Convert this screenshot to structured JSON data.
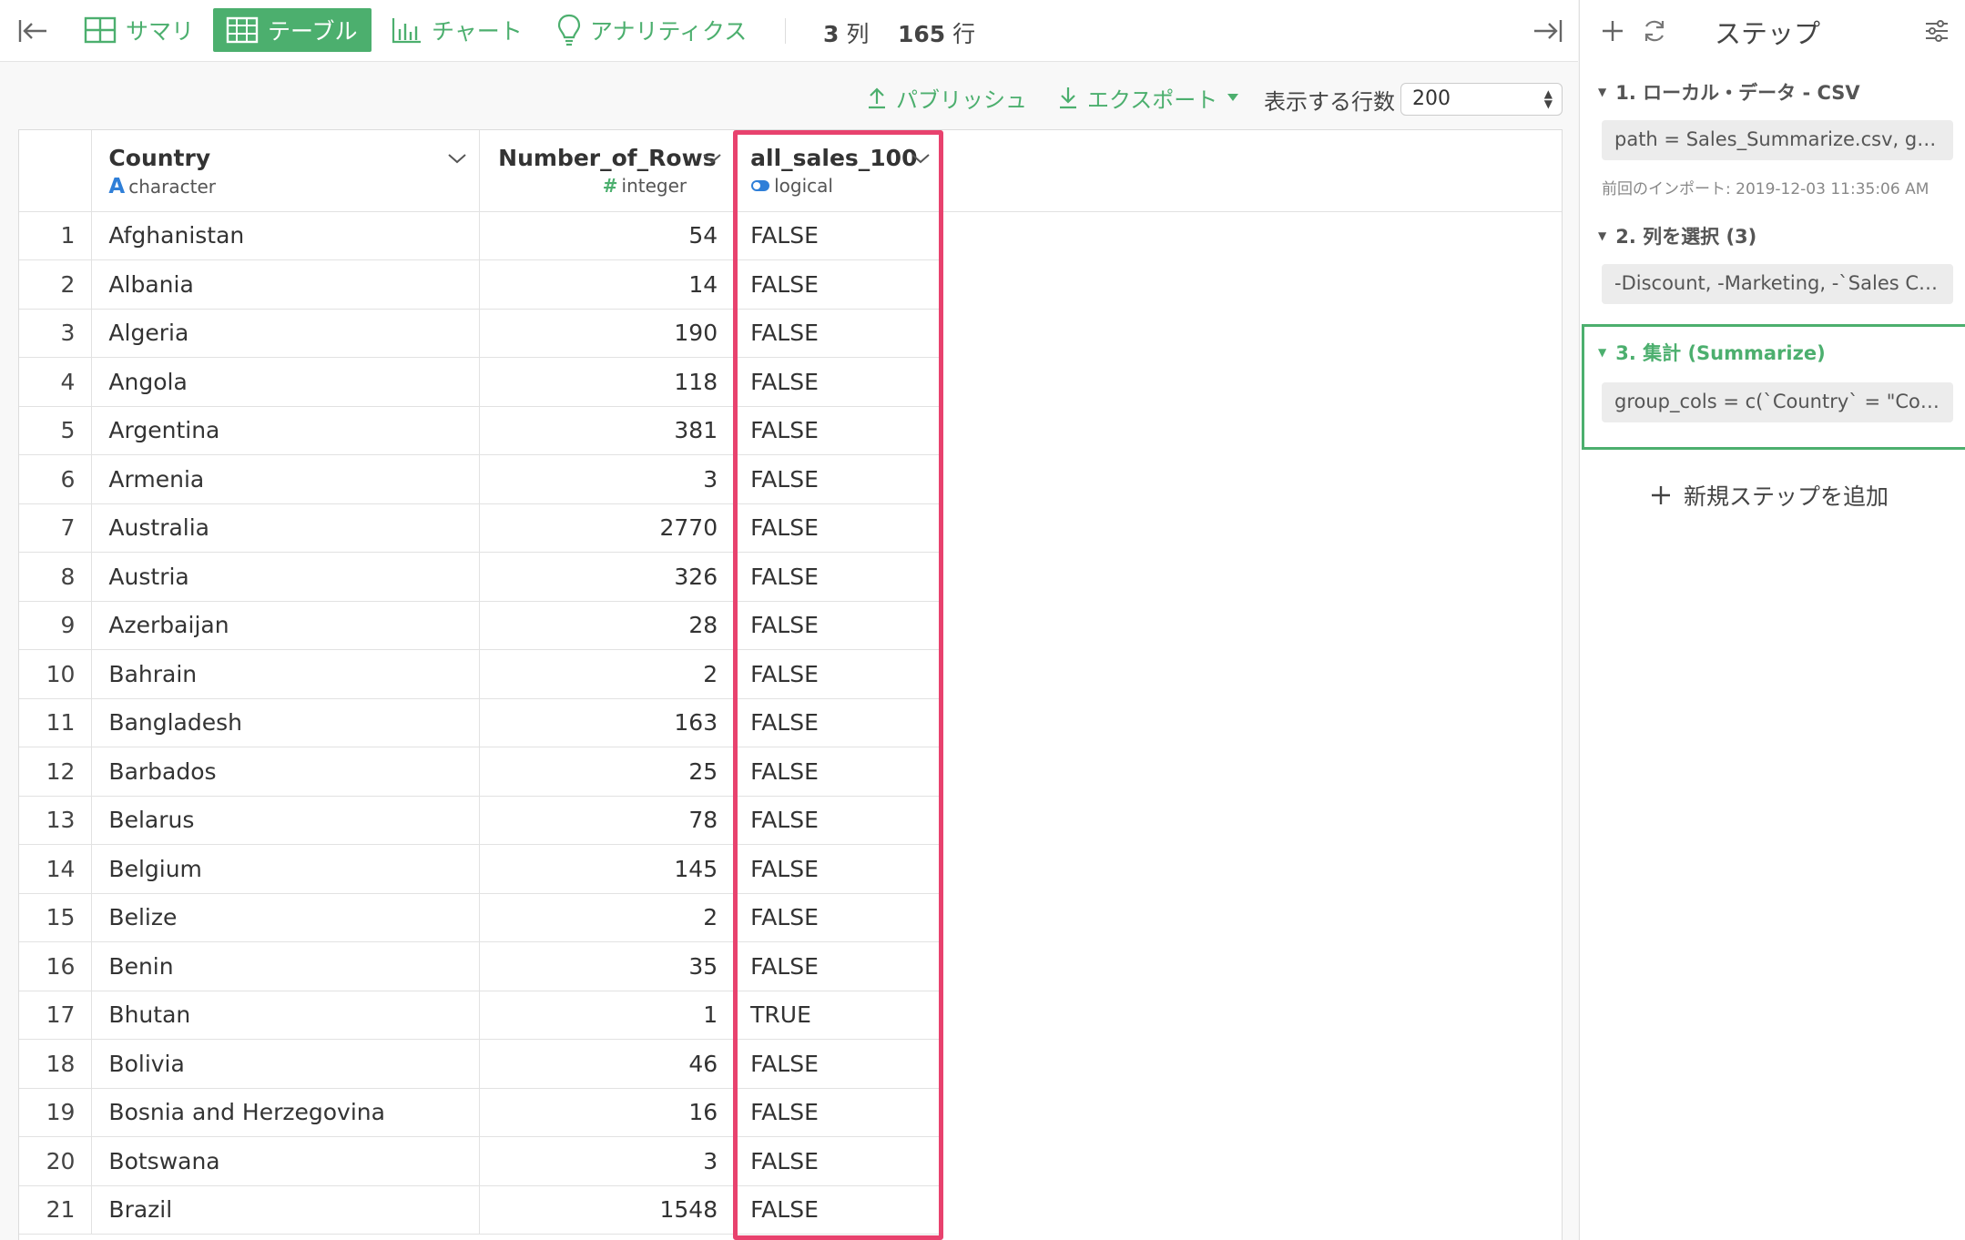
{
  "toolbar": {
    "tabs": [
      {
        "label": "サマリ",
        "icon": "summary-grid-icon"
      },
      {
        "label": "テーブル",
        "icon": "table-icon",
        "active": true
      },
      {
        "label": "チャート",
        "icon": "bar-chart-icon"
      },
      {
        "label": "アナリティクス",
        "icon": "lightbulb-icon"
      }
    ],
    "columns_count": "3",
    "columns_unit": "列",
    "rows_count": "165",
    "rows_unit": "行"
  },
  "subbar": {
    "publish_label": "パブリッシュ",
    "export_label": "エクスポート",
    "rows_label": "表示する行数",
    "rows_value": "200"
  },
  "table": {
    "columns": [
      {
        "name": "Country",
        "type": "character",
        "type_icon": "A"
      },
      {
        "name": "Number_of_Rows",
        "type": "integer",
        "type_icon": "#"
      },
      {
        "name": "all_sales_100",
        "type": "logical",
        "type_icon": "toggle-icon"
      }
    ],
    "rows": [
      {
        "n": "1",
        "country": "Afghanistan",
        "count": "54",
        "flag": "FALSE"
      },
      {
        "n": "2",
        "country": "Albania",
        "count": "14",
        "flag": "FALSE"
      },
      {
        "n": "3",
        "country": "Algeria",
        "count": "190",
        "flag": "FALSE"
      },
      {
        "n": "4",
        "country": "Angola",
        "count": "118",
        "flag": "FALSE"
      },
      {
        "n": "5",
        "country": "Argentina",
        "count": "381",
        "flag": "FALSE"
      },
      {
        "n": "6",
        "country": "Armenia",
        "count": "3",
        "flag": "FALSE"
      },
      {
        "n": "7",
        "country": "Australia",
        "count": "2770",
        "flag": "FALSE"
      },
      {
        "n": "8",
        "country": "Austria",
        "count": "326",
        "flag": "FALSE"
      },
      {
        "n": "9",
        "country": "Azerbaijan",
        "count": "28",
        "flag": "FALSE"
      },
      {
        "n": "10",
        "country": "Bahrain",
        "count": "2",
        "flag": "FALSE"
      },
      {
        "n": "11",
        "country": "Bangladesh",
        "count": "163",
        "flag": "FALSE"
      },
      {
        "n": "12",
        "country": "Barbados",
        "count": "25",
        "flag": "FALSE"
      },
      {
        "n": "13",
        "country": "Belarus",
        "count": "78",
        "flag": "FALSE"
      },
      {
        "n": "14",
        "country": "Belgium",
        "count": "145",
        "flag": "FALSE"
      },
      {
        "n": "15",
        "country": "Belize",
        "count": "2",
        "flag": "FALSE"
      },
      {
        "n": "16",
        "country": "Benin",
        "count": "35",
        "flag": "FALSE"
      },
      {
        "n": "17",
        "country": "Bhutan",
        "count": "1",
        "flag": "TRUE"
      },
      {
        "n": "18",
        "country": "Bolivia",
        "count": "46",
        "flag": "FALSE"
      },
      {
        "n": "19",
        "country": "Bosnia and Herzegovina",
        "count": "16",
        "flag": "FALSE"
      },
      {
        "n": "20",
        "country": "Botswana",
        "count": "3",
        "flag": "FALSE"
      },
      {
        "n": "21",
        "country": "Brazil",
        "count": "1548",
        "flag": "FALSE"
      }
    ]
  },
  "panel": {
    "title": "ステップ",
    "steps": [
      {
        "title": "1. ローカル・データ - CSV",
        "body": "path = Sales_Summarize.csv, grou…",
        "note": "前回のインポート: 2019-12-03 11:35:06 AM"
      },
      {
        "title": "2. 列を選択 (3)",
        "body": "-Discount, -Marketing, -`Sales Co…"
      },
      {
        "title": "3. 集計 (Summarize)",
        "body": "group_cols = c(`Country` = \"Countr…"
      }
    ],
    "add_step_label": "新規ステップを追加"
  },
  "colors": {
    "accent": "#4caf6e",
    "highlight": "#e8426e",
    "logical_icon": "#2f7fd8"
  }
}
